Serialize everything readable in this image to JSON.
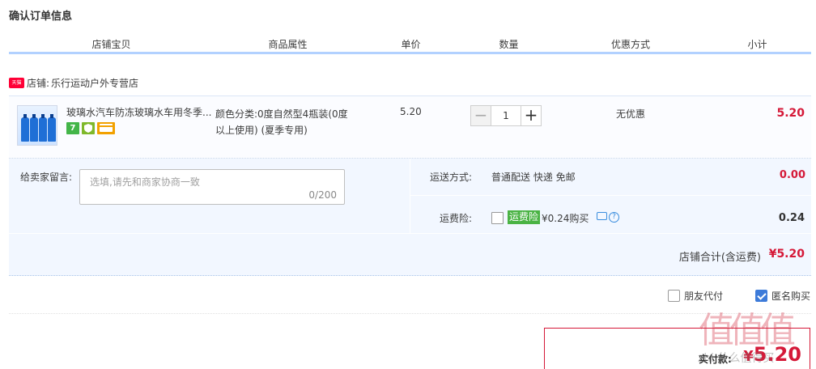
{
  "page": {
    "title": "确认订单信息"
  },
  "columns": [
    "店铺宝贝",
    "商品属性",
    "单价",
    "数量",
    "优惠方式",
    "小计"
  ],
  "shop": {
    "badge": "天猫",
    "label": "店铺:",
    "name": "乐行运动户外专营店"
  },
  "item": {
    "title": "玻璃水汽车防冻玻璃水车用冬季...",
    "icons": [
      "seven-day-return-icon",
      "shield-icon",
      "card-icon"
    ],
    "seven_label": "7",
    "attr_line1": "颜色分类:0度自然型4瓶装(0度",
    "attr_line2": "以上使用) (夏季专用)",
    "price": "5.20",
    "quantity": "1",
    "minus": "−",
    "plus": "+",
    "discount": "无优惠",
    "subtotal": "5.20"
  },
  "memo": {
    "label": "给卖家留言:",
    "placeholder": "选填,请先和商家协商一致",
    "count": "0/200"
  },
  "shipping": {
    "label": "运送方式:",
    "method": "普通配送 快递 免邮",
    "cost": "0.00"
  },
  "insurance": {
    "label": "运费险:",
    "tag": "运费险",
    "price": "¥0.24购买",
    "help": "?",
    "cost": "0.24"
  },
  "shop_total": {
    "label": "店铺合计(含运费)",
    "value": "¥5.20"
  },
  "options": {
    "friend_pay": "朋友代付",
    "anonymous": "匿名购买",
    "anonymous_checked": true,
    "friend_checked": false
  },
  "payment": {
    "label": "实付款:",
    "currency": "¥",
    "value": "5.20"
  },
  "watermark": {
    "big": "值值值",
    "small": "zhi  什么值得买"
  },
  "colors": {
    "accent_red": "#d51938",
    "header_line": "#b2d1ff",
    "panel_bg": "#f2f7ff",
    "tmall_red": "#ff0036"
  }
}
